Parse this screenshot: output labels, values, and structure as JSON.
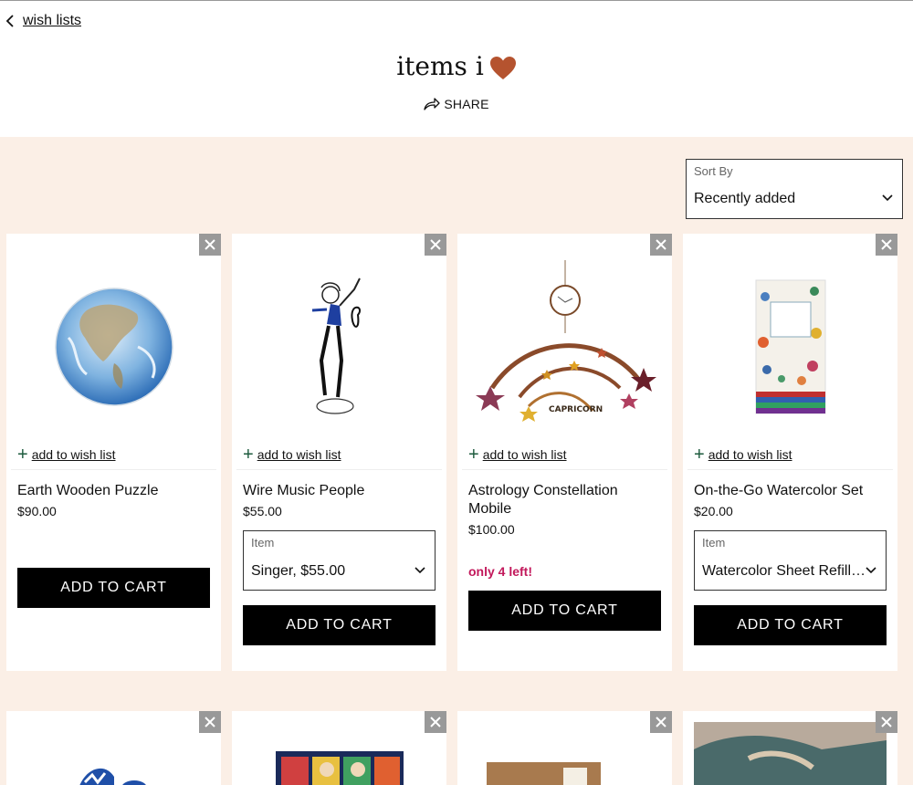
{
  "nav": {
    "back_label": "wish lists"
  },
  "header": {
    "title": "items i",
    "title_icon": "heart-icon",
    "share_label": "SHARE"
  },
  "sort": {
    "label": "Sort By",
    "value": "Recently added"
  },
  "colors": {
    "band": "#fbefe6",
    "heart": "#b5532f",
    "accent_green": "#1d5b3e",
    "stock_alert": "#c2185b",
    "cart_button": "#000000"
  },
  "products": [
    {
      "name": "Earth Wooden Puzzle",
      "price": "$90.00",
      "wish_label": "add to wish list",
      "cart_label": "ADD TO CART"
    },
    {
      "name": "Wire Music People",
      "price": "$55.00",
      "wish_label": "add to wish list",
      "option_label": "Item",
      "option_value": "Singer, $55.00",
      "cart_label": "ADD TO CART"
    },
    {
      "name": "Astrology Constellation Mobile",
      "price": "$100.00",
      "wish_label": "add to wish list",
      "stock_note": "only 4 left!",
      "cart_label": "ADD TO CART"
    },
    {
      "name": "On-the-Go Watercolor Set",
      "price": "$20.00",
      "wish_label": "add to wish list",
      "option_label": "Item",
      "option_value": "Watercolor Sheet Refill Pack",
      "cart_label": "ADD TO CART"
    }
  ]
}
